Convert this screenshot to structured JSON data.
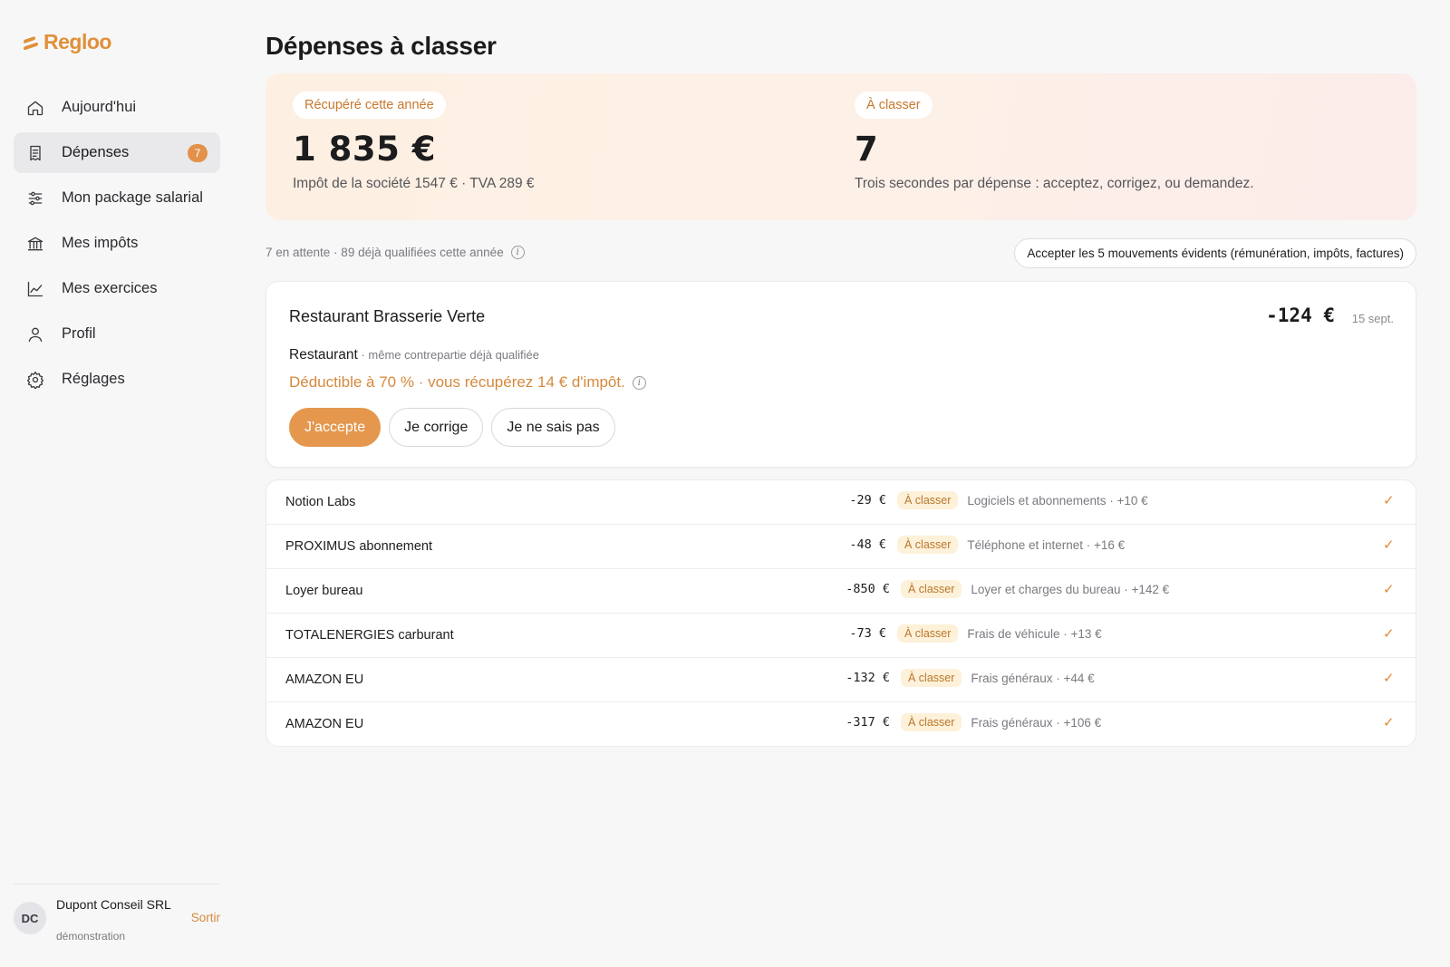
{
  "brand": {
    "name": "Regloo"
  },
  "nav": {
    "items": [
      {
        "label": "Aujourd'hui",
        "icon": "home-icon"
      },
      {
        "label": "Dépenses",
        "icon": "receipt-icon",
        "badge": "7",
        "active": true
      },
      {
        "label": "Mon package salarial",
        "icon": "sliders-icon"
      },
      {
        "label": "Mes impôts",
        "icon": "bank-icon"
      },
      {
        "label": "Mes exercices",
        "icon": "chart-line-icon"
      },
      {
        "label": "Profil",
        "icon": "user-icon"
      },
      {
        "label": "Réglages",
        "icon": "gear-icon"
      }
    ]
  },
  "user": {
    "initials": "DC",
    "name": "Dupont Conseil SRL",
    "subtitle": "démonstration",
    "logout_label": "Sortir"
  },
  "page": {
    "title": "Dépenses à classer"
  },
  "hero": {
    "left": {
      "pill": "Récupéré cette année",
      "value": "1 835  €",
      "subtitle": "Impôt de la société 1547 € · TVA 289 €"
    },
    "right": {
      "pill": "À classer",
      "value": "7",
      "subtitle": "Trois secondes par dépense : acceptez, corrigez, ou demandez."
    }
  },
  "summary": {
    "text": "7 en attente · 89 déjà qualifiées cette année",
    "accept_all_label": "Accepter les 5 mouvements évidents (rémunération, impôts, factures)"
  },
  "featured": {
    "title": "Restaurant Brasserie Verte",
    "amount": "-124  €",
    "date": "15 sept.",
    "category": "Restaurant",
    "category_note": " · même contrepartie déjà qualifiée",
    "deduction": "Déductible à 70 % · vous récupérez 14 € d'impôt.",
    "actions": {
      "accept": "J'accepte",
      "correct": "Je corrige",
      "unknown": "Je ne sais pas"
    }
  },
  "transactions": [
    {
      "name": "Notion Labs",
      "amount": "-29  €",
      "badge": "À classer",
      "info": "Logiciels et abonnements · +10 €"
    },
    {
      "name": "PROXIMUS abonnement",
      "amount": "-48  €",
      "badge": "À classer",
      "info": "Téléphone et internet · +16 €"
    },
    {
      "name": "Loyer bureau",
      "amount": "-850  €",
      "badge": "À classer",
      "info": "Loyer et charges du bureau · +142 €"
    },
    {
      "name": "TOTALENERGIES carburant",
      "amount": "-73  €",
      "badge": "À classer",
      "info": "Frais de véhicule · +13 €"
    },
    {
      "name": "AMAZON EU",
      "amount": "-132  €",
      "badge": "À classer",
      "info": "Frais généraux · +44 €"
    },
    {
      "name": "AMAZON EU",
      "amount": "-317  €",
      "badge": "À classer",
      "info": "Frais généraux · +106 €"
    }
  ],
  "colors": {
    "accent": "#e4974d",
    "badge_bg": "#fdf1d9"
  }
}
